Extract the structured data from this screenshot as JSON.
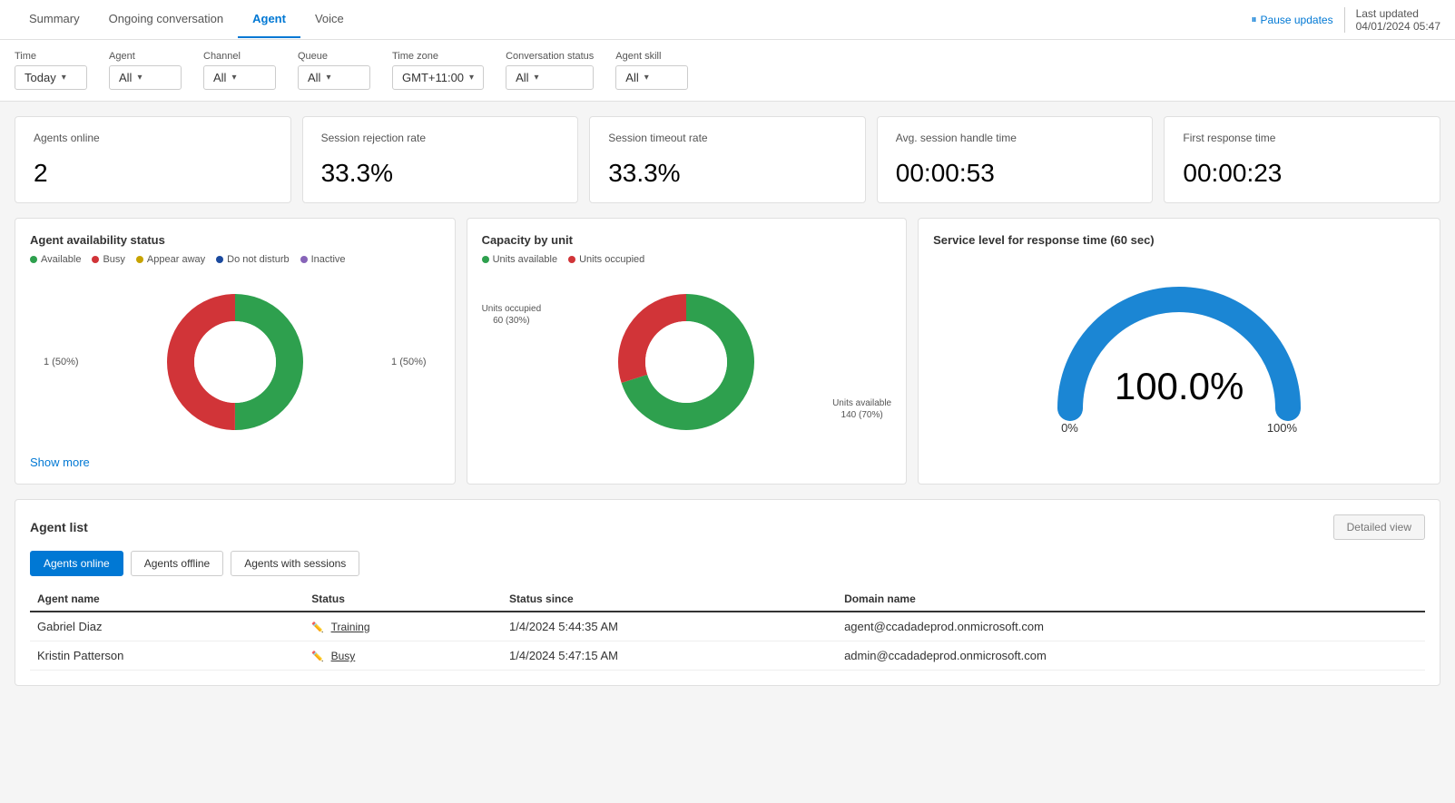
{
  "nav": {
    "tabs": [
      {
        "label": "Summary",
        "active": false
      },
      {
        "label": "Ongoing conversation",
        "active": false
      },
      {
        "label": "Agent",
        "active": true
      },
      {
        "label": "Voice",
        "active": false
      }
    ],
    "pause_label": "Pause updates",
    "last_updated_label": "Last updated",
    "last_updated_value": "04/01/2024 05:47"
  },
  "filters": [
    {
      "label": "Time",
      "value": "Today"
    },
    {
      "label": "Agent",
      "value": "All"
    },
    {
      "label": "Channel",
      "value": "All"
    },
    {
      "label": "Queue",
      "value": "All"
    },
    {
      "label": "Time zone",
      "value": "GMT+11:00"
    },
    {
      "label": "Conversation status",
      "value": "All"
    },
    {
      "label": "Agent skill",
      "value": "All"
    }
  ],
  "metrics": [
    {
      "title": "Agents online",
      "value": "2"
    },
    {
      "title": "Session rejection rate",
      "value": "33.3%"
    },
    {
      "title": "Session timeout rate",
      "value": "33.3%"
    },
    {
      "title": "Avg. session handle time",
      "value": "00:00:53"
    },
    {
      "title": "First response time",
      "value": "00:00:23"
    }
  ],
  "availability_chart": {
    "title": "Agent availability status",
    "legend": [
      {
        "label": "Available",
        "color": "#2ea04e"
      },
      {
        "label": "Busy",
        "color": "#d13438"
      },
      {
        "label": "Appear away",
        "color": "#c7a300"
      },
      {
        "label": "Do not disturb",
        "color": "#1b4a9e"
      },
      {
        "label": "Inactive",
        "color": "#8764b8"
      }
    ],
    "segments": [
      {
        "value": 50,
        "color": "#2ea04e",
        "label": "1 (50%)"
      },
      {
        "value": 50,
        "color": "#d13438",
        "label": "1 (50%)"
      }
    ],
    "label_left": "1 (50%)",
    "label_right": "1 (50%)",
    "show_more": "Show more"
  },
  "capacity_chart": {
    "title": "Capacity by unit",
    "legend": [
      {
        "label": "Units available",
        "color": "#2ea04e"
      },
      {
        "label": "Units occupied",
        "color": "#d13438"
      }
    ],
    "segments": [
      {
        "value": 70,
        "color": "#2ea04e",
        "label": "Units available\n140 (70%)"
      },
      {
        "value": 30,
        "color": "#d13438",
        "label": "Units occupied\n60 (30%)"
      }
    ],
    "label_occupied": "Units occupied\n60 (30%)",
    "label_available": "Units available\n140 (70%)"
  },
  "service_level_chart": {
    "title": "Service level for response time (60 sec)",
    "value": "100.0%",
    "label_0": "0%",
    "label_100": "100%",
    "percentage": 100,
    "color": "#1b86d4"
  },
  "agent_list": {
    "title": "Agent list",
    "tabs": [
      {
        "label": "Agents online",
        "active": true
      },
      {
        "label": "Agents offline",
        "active": false
      },
      {
        "label": "Agents with sessions",
        "active": false
      }
    ],
    "detailed_view_label": "Detailed view",
    "columns": [
      "Agent name",
      "Status",
      "Status since",
      "Domain name"
    ],
    "rows": [
      {
        "name": "Gabriel Diaz",
        "status": "Training",
        "since": "1/4/2024 5:44:35 AM",
        "domain": "agent@ccadadeprod.onmicrosoft.com"
      },
      {
        "name": "Kristin Patterson",
        "status": "Busy",
        "since": "1/4/2024 5:47:15 AM",
        "domain": "admin@ccadadeprod.onmicrosoft.com"
      }
    ]
  }
}
